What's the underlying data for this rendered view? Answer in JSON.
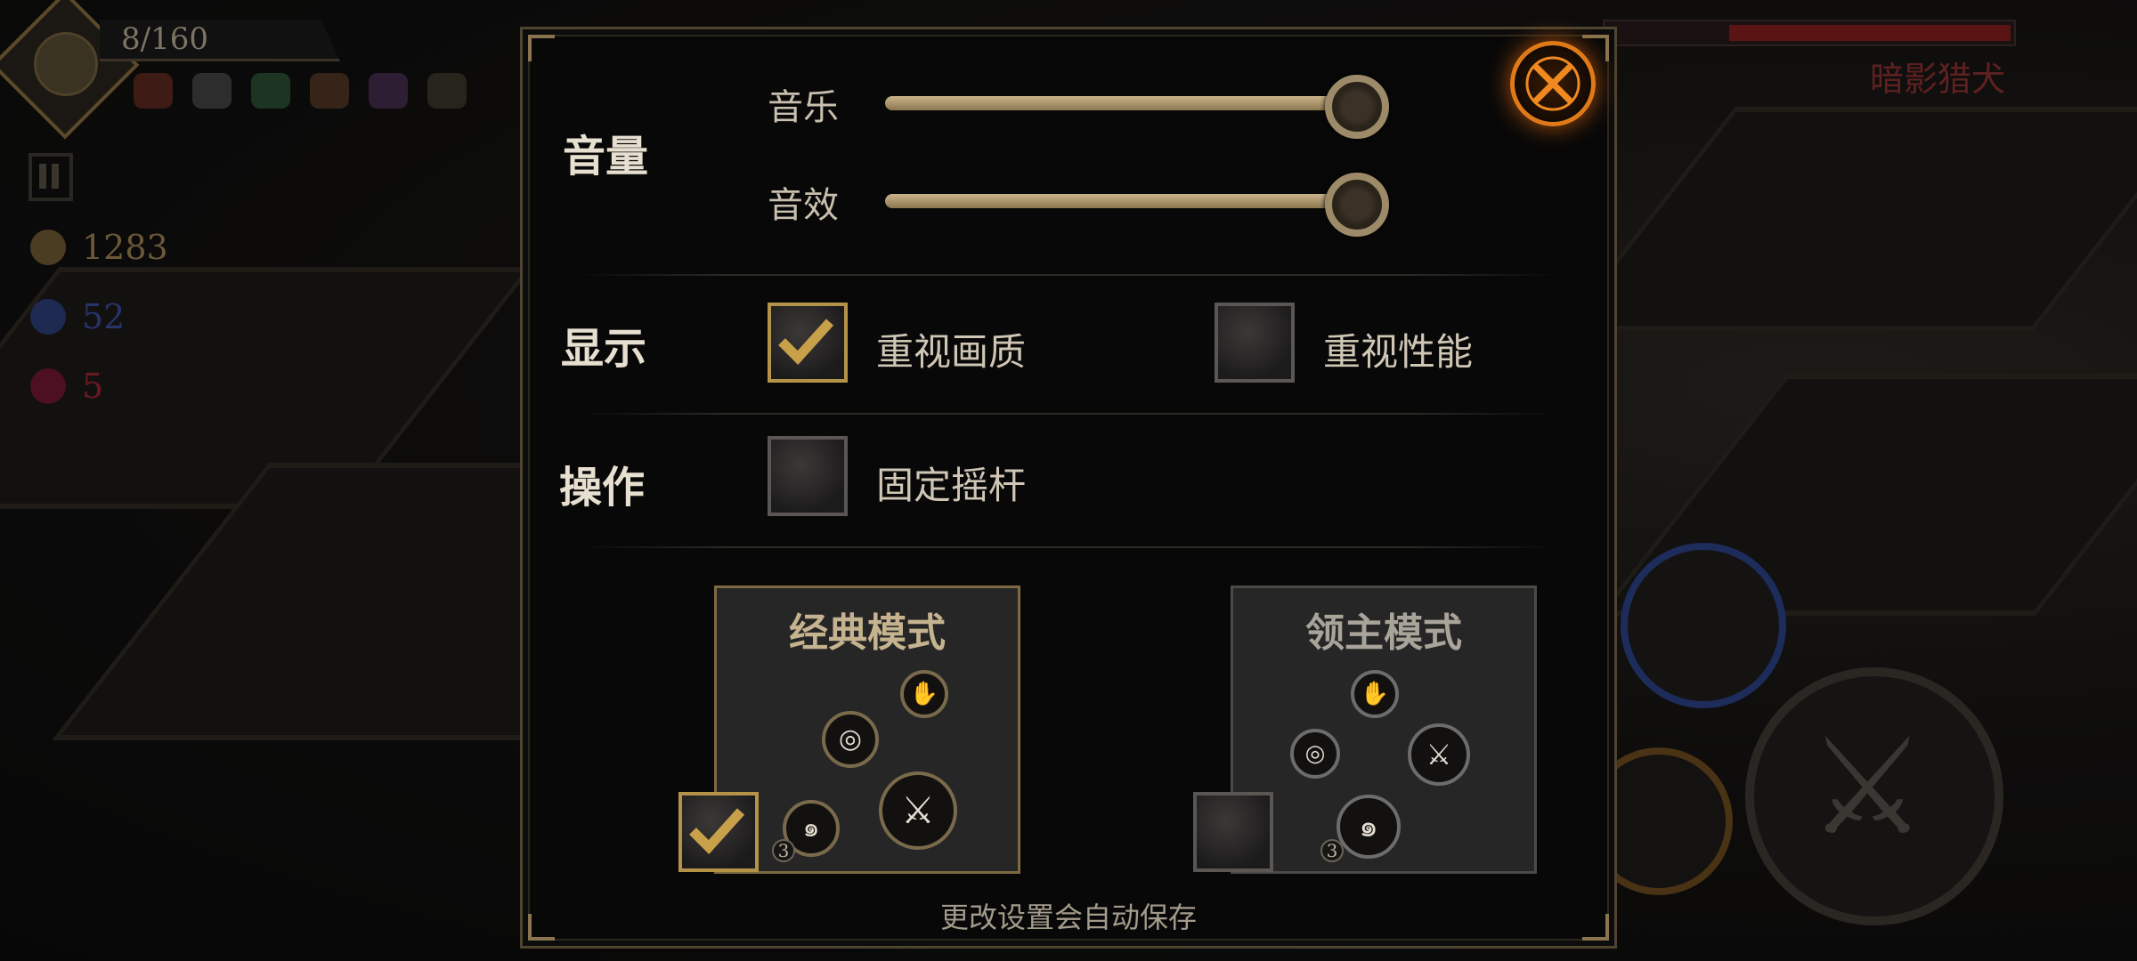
{
  "hud": {
    "level": "8/160",
    "gold": "1283",
    "gems": "52",
    "red": "5",
    "enemy_name": "暗影猎犬",
    "enemy_health_fraction": 0.7
  },
  "settings": {
    "volume": {
      "section_label": "音量",
      "music_label": "音乐",
      "music_level": 1.0,
      "sfx_label": "音效",
      "sfx_level": 1.0
    },
    "display": {
      "section_label": "显示",
      "quality_label": "重视画质",
      "quality_checked": true,
      "performance_label": "重视性能",
      "performance_checked": false
    },
    "controls": {
      "section_label": "操作",
      "fixed_joystick_label": "固定摇杆",
      "fixed_joystick_checked": false
    },
    "modes": {
      "classic_label": "经典模式",
      "classic_selected": true,
      "lord_label": "领主模式",
      "lord_selected": false,
      "skill_charge_count": "3"
    },
    "footer": "更改设置会自动保存"
  },
  "colors": {
    "accent_gold": "#b49248",
    "close_orange": "#e07a18",
    "gold_text": "#6a5838",
    "gem_blue": "#27336a",
    "red_text": "#6a1822"
  }
}
